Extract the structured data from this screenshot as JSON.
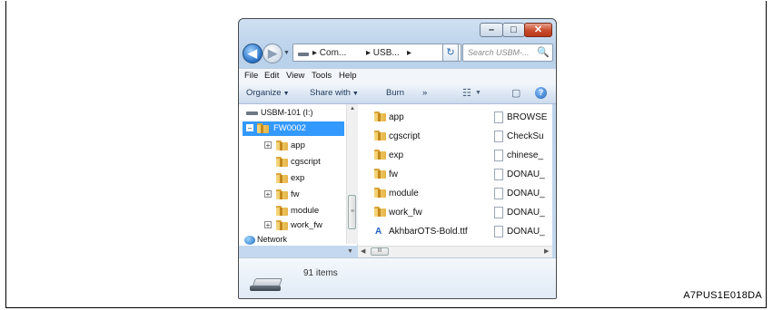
{
  "figure_code": "A7PUS1E018DA",
  "window": {
    "title_buttons": {
      "minimize": "–",
      "maximize": "□",
      "close": "✕"
    },
    "nav": {
      "back_glyph": "◀",
      "forward_glyph": "▶",
      "recent_glyph": "▼"
    },
    "address": {
      "drive_icon": "drive-icon",
      "crumbs": [
        "▸ Com...",
        "▸ USB...",
        "▸"
      ],
      "dropdown_glyph": "▼",
      "refresh_glyph": "↻"
    },
    "search": {
      "placeholder": "Search USBM-...",
      "icon": "🔍"
    },
    "menu": [
      "File",
      "Edit",
      "View",
      "Tools",
      "Help"
    ],
    "commands": {
      "organize": "Organize",
      "share": "Share with",
      "burn": "Burn",
      "more": "»",
      "views_glyph": "☷",
      "caret": "▼",
      "preview_glyph": "▢",
      "help_glyph": "?"
    },
    "tree": {
      "drive": "USBM-101 (I:)",
      "selected": "FW0002",
      "items": [
        "app",
        "cgscript",
        "exp",
        "fw",
        "module",
        "work_fw"
      ],
      "network": "Network",
      "expander_plus": "+",
      "expander_minus": "−"
    },
    "files": {
      "col1": [
        "app",
        "cgscript",
        "exp",
        "fw",
        "module",
        "work_fw",
        "AkhbarOTS-Bold.ttf"
      ],
      "col2": [
        "BROWSE",
        "CheckSu",
        "chinese_",
        "DONAU_",
        "DONAU_",
        "DONAU_",
        "DONAU_"
      ]
    },
    "scroll": {
      "up": "▲",
      "down": "▼",
      "left": "◀",
      "right": "▶",
      "grip": "≡",
      "hgrip": "III"
    },
    "status": {
      "count": "91 items"
    }
  },
  "colors": {
    "selection": "#3399ff",
    "folder": "#e5b447"
  }
}
